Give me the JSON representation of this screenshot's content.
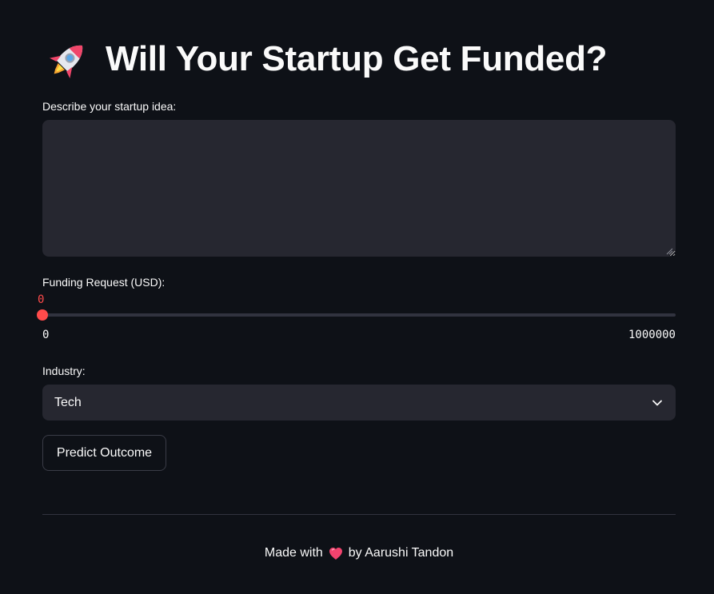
{
  "header": {
    "icon": "rocket-icon",
    "title": "Will Your Startup Get Funded?"
  },
  "idea": {
    "label": "Describe your startup idea:",
    "value": "",
    "placeholder": ""
  },
  "funding": {
    "label": "Funding Request (USD):",
    "current": "0",
    "min": "0",
    "max": "1000000",
    "fill_fraction": 0,
    "accent_color": "#ff4b4b"
  },
  "industry": {
    "label": "Industry:",
    "selected": "Tech",
    "icon": "chevron-down-icon"
  },
  "actions": {
    "predict_label": "Predict Outcome"
  },
  "footer": {
    "prefix": "Made with",
    "icon": "heart-icon",
    "suffix": "by Aarushi Tandon"
  },
  "theme": {
    "background": "#0e1117",
    "input_background": "#262730",
    "text": "#fafafa",
    "accent": "#ff4b4b"
  }
}
